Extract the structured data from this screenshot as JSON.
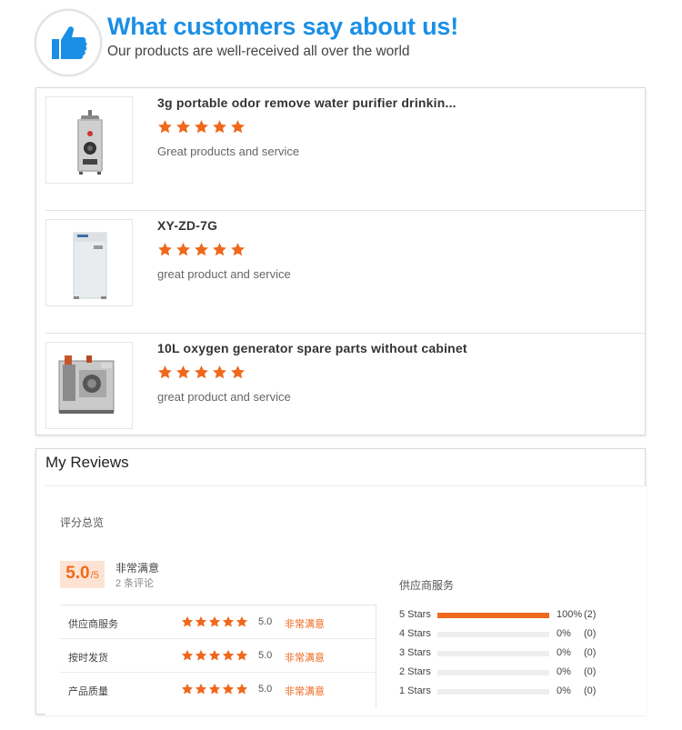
{
  "header": {
    "title": "What customers say about us!",
    "subtitle": "Our products are well-received all over the world",
    "icon": "thumbs-up-icon",
    "accent_color": "#1b8fe5"
  },
  "star_color": "#f0681c",
  "products": [
    {
      "title": "3g portable odor remove water purifier drinkin...",
      "rating": 5,
      "comment": "Great products and service",
      "image": "portable-ozone-generator"
    },
    {
      "title": "XY-ZD-7G",
      "rating": 5,
      "comment": "great product and service",
      "image": "white-cabinet-ozone-generator"
    },
    {
      "title": "10L oxygen generator spare parts without cabinet",
      "rating": 5,
      "comment": "great product and service",
      "image": "oxygen-generator-parts"
    }
  ],
  "my_reviews": {
    "title": "My Reviews",
    "overview_label": "评分总览",
    "score": "5.0",
    "score_suffix": "/5",
    "satisfaction": "非常满意",
    "review_count": "2 条评论",
    "categories": [
      {
        "label": "供应商服务",
        "stars": 5,
        "score": "5.0",
        "satisfaction": "非常满意"
      },
      {
        "label": "按时发货",
        "stars": 5,
        "score": "5.0",
        "satisfaction": "非常满意"
      },
      {
        "label": "产品质量",
        "stars": 5,
        "score": "5.0",
        "satisfaction": "非常满意"
      }
    ],
    "supplier_service_label": "供应商服务",
    "distribution": [
      {
        "label": "5 Stars",
        "percent_text": "100%",
        "count": "(2)",
        "fraction": 1.0
      },
      {
        "label": "4 Stars",
        "percent_text": "0%",
        "count": "(0)",
        "fraction": 0
      },
      {
        "label": "3 Stars",
        "percent_text": "0%",
        "count": "(0)",
        "fraction": 0
      },
      {
        "label": "2 Stars",
        "percent_text": "0%",
        "count": "(0)",
        "fraction": 0
      },
      {
        "label": "1 Stars",
        "percent_text": "0%",
        "count": "(0)",
        "fraction": 0
      }
    ]
  }
}
